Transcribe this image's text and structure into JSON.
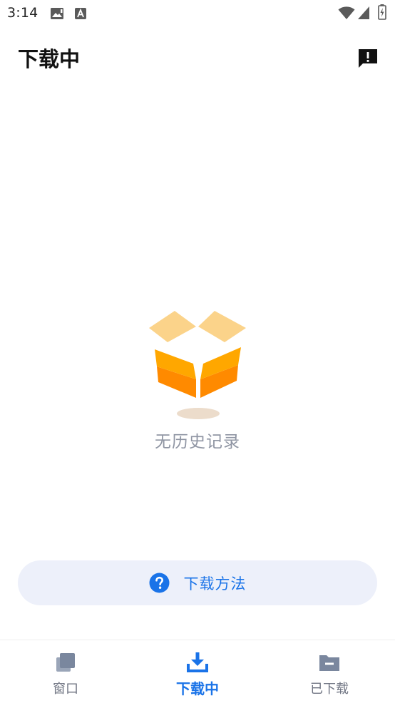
{
  "status_bar": {
    "time": "3:14",
    "icons": [
      "image-icon",
      "a-icon",
      "wifi-icon",
      "signal-icon",
      "battery-icon"
    ]
  },
  "header": {
    "title": "下载中",
    "action_icon": "feedback-icon"
  },
  "empty_state": {
    "illustration": "open-box-icon",
    "message": "无历史记录"
  },
  "help_button": {
    "icon": "help-icon",
    "label": "下载方法"
  },
  "bottom_nav": {
    "items": [
      {
        "label": "窗口",
        "icon": "windows-icon",
        "active": false
      },
      {
        "label": "下载中",
        "icon": "download-icon",
        "active": true
      },
      {
        "label": "已下载",
        "icon": "folder-icon",
        "active": false
      }
    ]
  },
  "colors": {
    "accent": "#1a73e8",
    "muted_text": "#8f95a3",
    "button_bg": "#edf0fa",
    "box_light": "#fbd38a",
    "box_mid": "#ffa700",
    "box_dark": "#ff8a00",
    "inactive_icon": "#7a879e"
  }
}
